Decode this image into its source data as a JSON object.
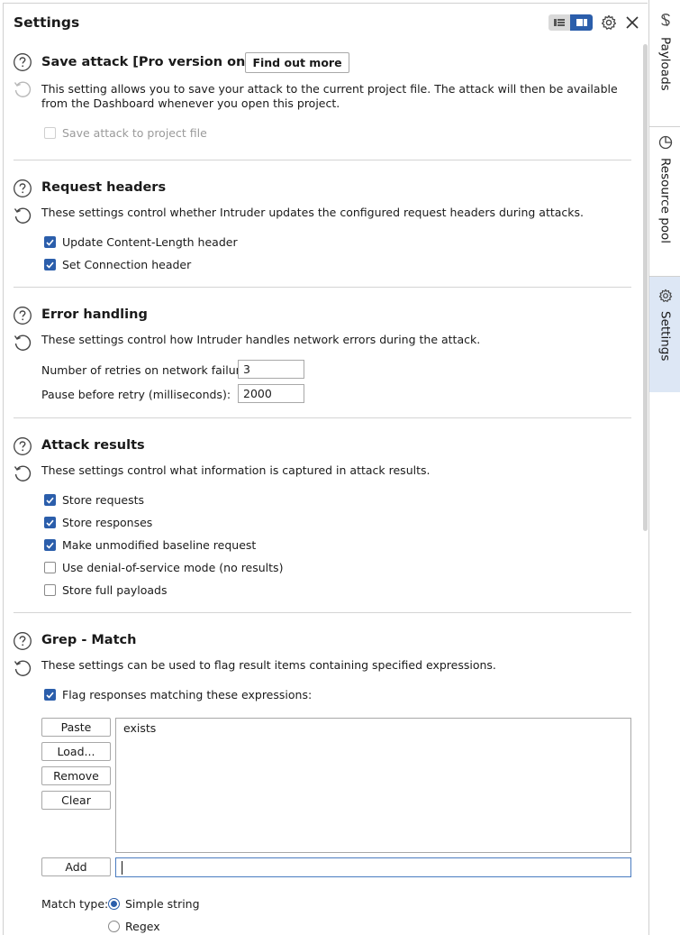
{
  "header": {
    "title": "Settings"
  },
  "sections": {
    "save_attack": {
      "title": "Save attack [Pro version only]",
      "button": "Find out more",
      "desc": "This setting allows you to save your attack to the current project file. The attack will then be available from the Dashboard whenever you open this project.",
      "checkbox": "Save attack to project file"
    },
    "request_headers": {
      "title": "Request headers",
      "desc": "These settings control whether Intruder updates the configured request headers during attacks.",
      "cb1": "Update Content-Length header",
      "cb2": "Set Connection header"
    },
    "error_handling": {
      "title": "Error handling",
      "desc": "These settings control how Intruder handles network errors during the attack.",
      "retries_label": "Number of retries on network failure:",
      "retries_value": "3",
      "pause_label": "Pause before retry (milliseconds):",
      "pause_value": "2000"
    },
    "attack_results": {
      "title": "Attack results",
      "desc": "These settings control what information is captured in attack results.",
      "cb1": "Store requests",
      "cb2": "Store responses",
      "cb3": "Make unmodified baseline request",
      "cb4": "Use denial-of-service mode (no results)",
      "cb5": "Store full payloads"
    },
    "grep_match": {
      "title": "Grep - Match",
      "desc": "These settings can be used to flag result items containing specified expressions.",
      "flag_label": "Flag responses matching these expressions:",
      "btn_paste": "Paste",
      "btn_load": "Load...",
      "btn_remove": "Remove",
      "btn_clear": "Clear",
      "btn_add": "Add",
      "list_items": [
        "exists"
      ],
      "match_type_label": "Match type:",
      "radio1": "Simple string",
      "radio2": "Regex"
    }
  },
  "side_tabs": {
    "payloads": "Payloads",
    "resource_pool": "Resource pool",
    "settings": "Settings"
  },
  "colors": {
    "accent": "#2b5eab",
    "active_tab_bg": "#dde7f5"
  }
}
